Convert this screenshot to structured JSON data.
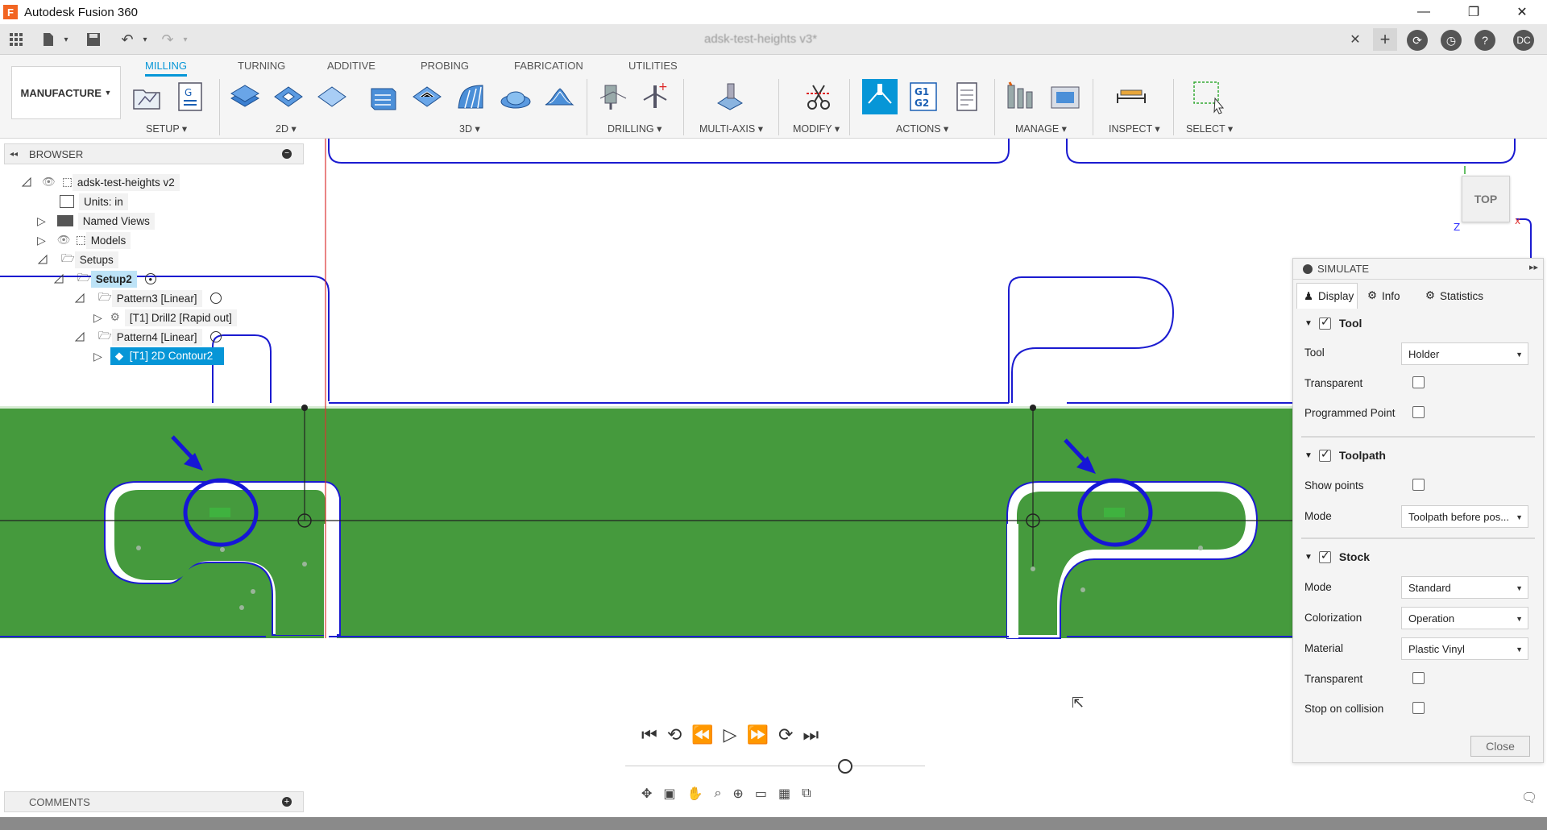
{
  "app": {
    "title": "Autodesk Fusion 360",
    "document_tab": "adsk-test-heights v3*",
    "user_initials": "DC"
  },
  "ribbon": {
    "workspace": "MANUFACTURE",
    "tabs": [
      "MILLING",
      "TURNING",
      "ADDITIVE",
      "PROBING",
      "FABRICATION",
      "UTILITIES"
    ],
    "groups": [
      "SETUP",
      "2D",
      "3D",
      "DRILLING",
      "MULTI-AXIS",
      "MODIFY",
      "ACTIONS",
      "MANAGE",
      "INSPECT",
      "SELECT"
    ]
  },
  "browser": {
    "title": "BROWSER",
    "nodes": [
      "adsk-test-heights v2",
      "Units: in",
      "Named Views",
      "Models",
      "Setups",
      "Setup2",
      "Pattern3 [Linear]",
      "[T1] Drill2 [Rapid out]",
      "Pattern4 [Linear]",
      "[T1] 2D Contour2"
    ]
  },
  "viewcube": {
    "face": "TOP"
  },
  "simulate": {
    "title": "SIMULATE",
    "tabs": [
      "Display",
      "Info",
      "Statistics"
    ],
    "tool": {
      "header": "Tool",
      "enabled": true,
      "tool_label": "Tool",
      "tool_value": "Holder",
      "transparent_label": "Transparent",
      "transparent": false,
      "programmed_point_label": "Programmed Point",
      "programmed_point": false
    },
    "toolpath": {
      "header": "Toolpath",
      "enabled": true,
      "show_points_label": "Show points",
      "show_points": false,
      "mode_label": "Mode",
      "mode_value": "Toolpath before pos..."
    },
    "stock": {
      "header": "Stock",
      "enabled": true,
      "mode_label": "Mode",
      "mode_value": "Standard",
      "colorization_label": "Colorization",
      "colorization_value": "Operation",
      "material_label": "Material",
      "material_value": "Plastic Vinyl",
      "transparent_label": "Transparent",
      "transparent": false,
      "stop_label": "Stop on collision",
      "stop_on_collision": false
    },
    "close_label": "Close"
  },
  "comments": {
    "title": "COMMENTS"
  },
  "colors": {
    "accent": "#0696d7",
    "stock": "#459a3d",
    "toolpath": "#1b1bd0",
    "annotation": "#1616d6"
  }
}
